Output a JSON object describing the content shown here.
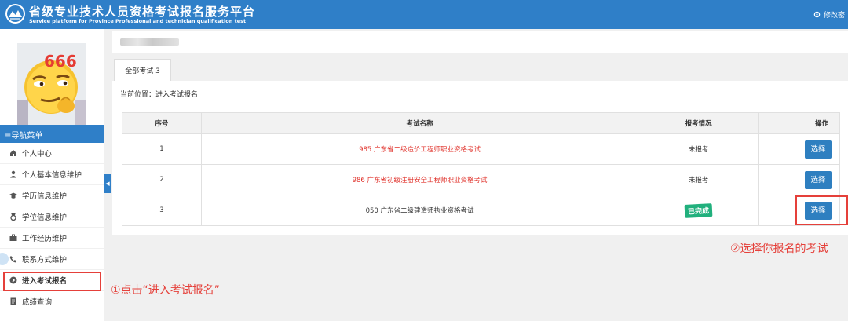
{
  "header": {
    "title_cn": "省级专业技术人员资格考试报名服务平台",
    "title_en": "Service platform for Province Professional and technician qualification test",
    "top_right_label": "修改密",
    "colors": {
      "bar": "#2f7fc8"
    }
  },
  "sidebar": {
    "avatar_text": "666",
    "nav_title": "≡导航菜单",
    "items": [
      {
        "label": "个人中心",
        "icon": "home-icon"
      },
      {
        "label": "个人基本信息维护",
        "icon": "user-icon"
      },
      {
        "label": "学历信息维护",
        "icon": "graduation-cap-icon"
      },
      {
        "label": "学位信息维护",
        "icon": "medal-icon"
      },
      {
        "label": "工作经历维护",
        "icon": "briefcase-icon"
      },
      {
        "label": "联系方式维护",
        "icon": "phone-icon"
      },
      {
        "label": "进入考试报名",
        "icon": "arrow-circle-icon",
        "active": true
      },
      {
        "label": "成绩查询",
        "icon": "document-icon"
      }
    ],
    "collapse_glyph": "◀"
  },
  "main": {
    "tab_label": "全部考试 3",
    "breadcrumb": "当前位置：进入考试报名",
    "table": {
      "headers": [
        "序号",
        "考试名称",
        "报考情况",
        "操作"
      ],
      "rows": [
        {
          "no": "1",
          "name": "985 广东省二级造价工程师职业资格考试",
          "status": "未报考",
          "action": "选择",
          "name_color": "red"
        },
        {
          "no": "2",
          "name": "986 广东省初级注册安全工程师职业资格考试",
          "status": "未报考",
          "action": "选择",
          "name_color": "red"
        },
        {
          "no": "3",
          "name": "050 广东省二级建造师执业资格考试",
          "status": "已完成",
          "action": "选择",
          "name_color": "normal"
        }
      ]
    }
  },
  "annotations": {
    "step1": "①点击“进入考试报名”",
    "step2": "②选择你报名的考试",
    "color": "#e5403a"
  }
}
